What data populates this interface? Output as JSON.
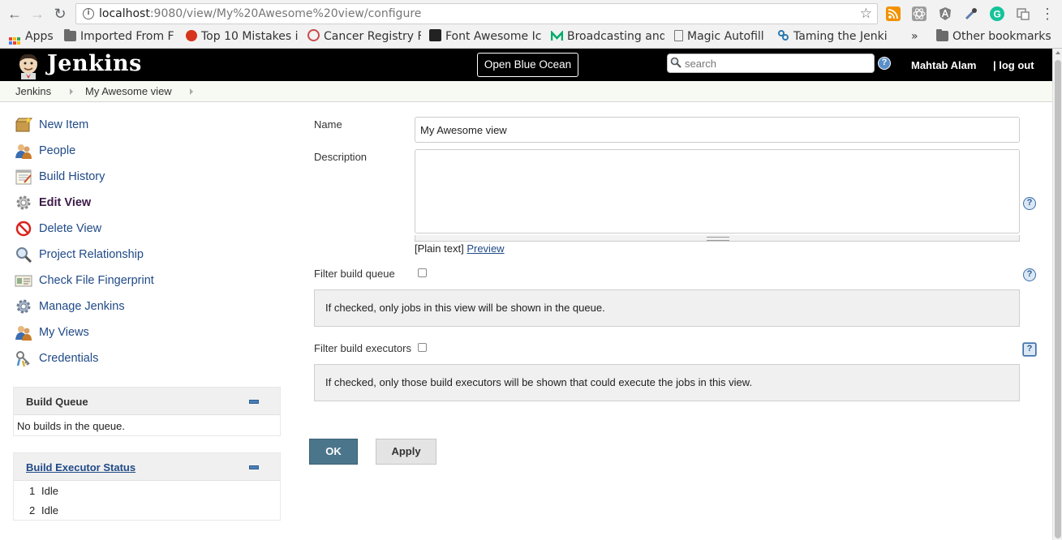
{
  "browser": {
    "url_host": "localhost",
    "url_rest": ":9080/view/My%20Awesome%20view/configure",
    "bookmarks": [
      {
        "label": "Apps"
      },
      {
        "label": "Imported From F"
      },
      {
        "label": "Top 10 Mistakes i"
      },
      {
        "label": "Cancer Registry F"
      },
      {
        "label": "Font Awesome Ic"
      },
      {
        "label": "Broadcasting and"
      },
      {
        "label": "Magic Autofill"
      },
      {
        "label": "Taming the Jenki"
      }
    ],
    "more_label": "»",
    "other_bookmarks": "Other bookmarks"
  },
  "header": {
    "title": "Jenkins",
    "blue_ocean": "Open Blue Ocean",
    "search_placeholder": "search",
    "help": "?",
    "user": "Mahtab Alam",
    "logout": "| log out"
  },
  "breadcrumb": [
    "Jenkins",
    "My Awesome view"
  ],
  "tasks": [
    {
      "label": "New Item",
      "icon": "new-item-icon"
    },
    {
      "label": "People",
      "icon": "people-icon"
    },
    {
      "label": "Build History",
      "icon": "notepad-icon"
    },
    {
      "label": "Edit View",
      "icon": "gear-icon"
    },
    {
      "label": "Delete View",
      "icon": "no-entry-icon"
    },
    {
      "label": "Project Relationship",
      "icon": "magnifier-icon"
    },
    {
      "label": "Check File Fingerprint",
      "icon": "fingerprint-icon"
    },
    {
      "label": "Manage Jenkins",
      "icon": "gear-icon"
    },
    {
      "label": "My Views",
      "icon": "people-icon"
    },
    {
      "label": "Credentials",
      "icon": "keys-icon"
    }
  ],
  "build_queue": {
    "title": "Build Queue",
    "empty": "No builds in the queue."
  },
  "executors": {
    "title": "Build Executor Status",
    "rows": [
      {
        "num": "1",
        "status": "Idle"
      },
      {
        "num": "2",
        "status": "Idle"
      }
    ]
  },
  "form": {
    "name_label": "Name",
    "name_value": "My Awesome view",
    "description_label": "Description",
    "description_value": "",
    "plain_text": "[Plain text]",
    "preview": "Preview",
    "filter_queue_label": "Filter build queue",
    "filter_queue_help": "If checked, only jobs in this view will be shown in the queue.",
    "filter_executors_label": "Filter build executors",
    "filter_executors_help": "If checked, only those build executors will be shown that could execute the jobs in this view.",
    "ok": "OK",
    "apply": "Apply"
  }
}
